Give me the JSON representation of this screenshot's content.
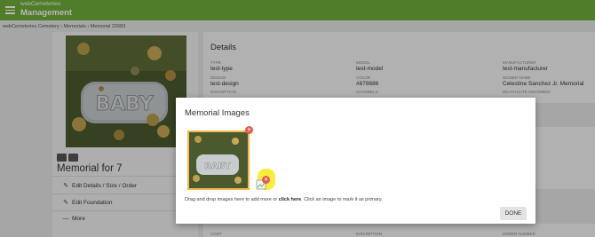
{
  "header": {
    "app_name": "webCemeteries",
    "section": "Management"
  },
  "breadcrumb": "webCemeteries Cemetery › Memorials › Memorial 22683",
  "photo": {
    "stone_text": "BABY",
    "toolbar_icons": [
      "image-icon",
      "map-icon"
    ]
  },
  "memorial": {
    "title": "Memorial for 7",
    "actions": [
      {
        "label": "Edit Details / Size / Order",
        "icon": "pencil-icon"
      },
      {
        "label": "Edit Foundation",
        "icon": "pencil-icon"
      },
      {
        "label": "More",
        "icon": "dash-icon"
      }
    ]
  },
  "details": {
    "title": "Details",
    "fields": [
      {
        "label": "TYPE",
        "value": "test-type"
      },
      {
        "label": "MODEL",
        "value": "test-model"
      },
      {
        "label": "MANUFACTURER",
        "value": "test-manufacturer"
      },
      {
        "label": "DESIGN",
        "value": "test-design"
      },
      {
        "label": "COLOR",
        "value": "#878686"
      },
      {
        "label": "SIGNER NAME",
        "value": "Celestine Sanchez Jr. Memorial"
      },
      {
        "label": "INSCRIPTION",
        "value": ""
      },
      {
        "label": "CHANNELS",
        "value": ""
      },
      {
        "label": "DEATH DATE INSCRIBED",
        "value": ""
      }
    ],
    "bottom_labels": [
      "COST",
      "INSCRIPTION",
      "ORDER NUMBER"
    ]
  },
  "modal": {
    "title": "Memorial Images",
    "hint_before": "Drag and drop images here to add more or ",
    "hint_link": "click here",
    "hint_after": ". Click an image to mark it as primary.",
    "done_label": "DONE",
    "remove_glyph": "×",
    "highlight_color": "#f7ee3c",
    "primary_border_color": "#f2b84b",
    "remove_color": "#e45b4f"
  }
}
